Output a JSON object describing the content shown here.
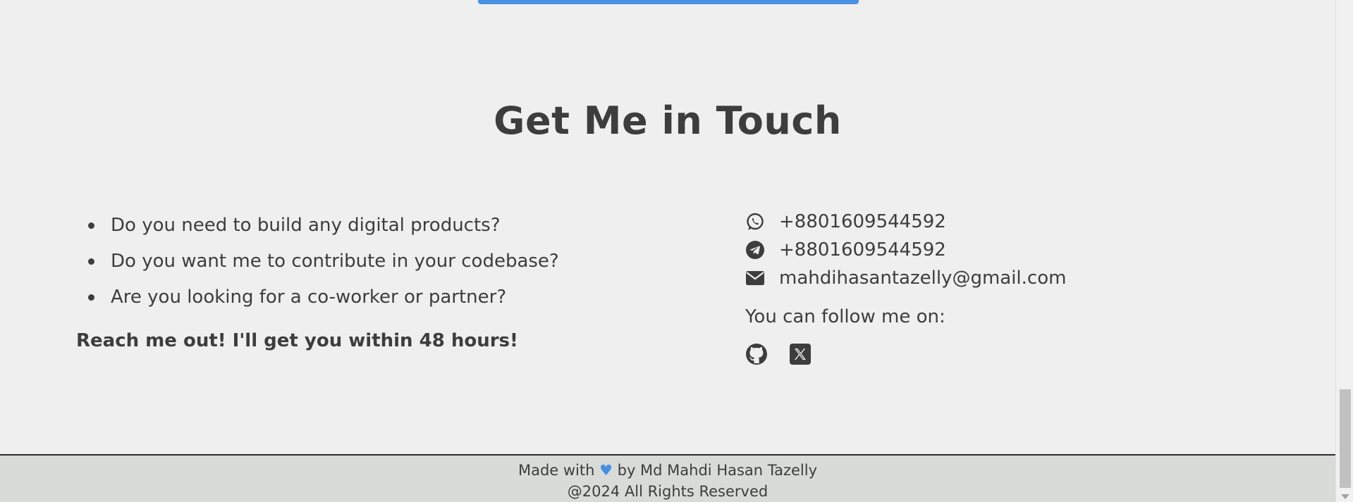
{
  "contact": {
    "title": "Get Me in Touch",
    "questions": [
      "Do you need to build any digital products?",
      "Do you want me to contribute in your codebase?",
      "Are you looking for a co-worker or partner?"
    ],
    "reach_out": "Reach me out! I'll get you within 48 hours!",
    "whatsapp": "+8801609544592",
    "telegram": "+8801609544592",
    "email": "mahdihasantazelly@gmail.com",
    "follow_text": "You can follow me on:",
    "icons": {
      "whatsapp": "whatsapp-icon",
      "telegram": "telegram-icon",
      "email": "envelope-icon",
      "github": "github-icon",
      "x": "x-twitter-icon"
    }
  },
  "footer": {
    "made_with": "Made with",
    "heart": "♥",
    "by": "by Md Mahdi Hasan Tazelly",
    "copyright": "@2024 All Rights Reserved"
  },
  "colors": {
    "accent": "#4a90e2",
    "background": "#efefef",
    "footer_bg": "#d9dbd9",
    "text": "#3d3d3d"
  }
}
